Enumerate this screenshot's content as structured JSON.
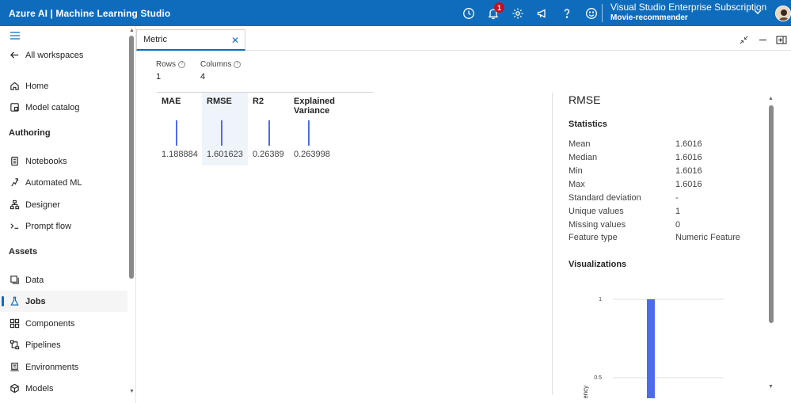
{
  "app": {
    "title": "Azure AI | Machine Learning Studio"
  },
  "header": {
    "notification_count": "1",
    "subscription": "Visual Studio Enterprise Subscription",
    "workspace": "Movie-recommender",
    "icons": [
      "clock-icon",
      "bell-icon",
      "gear-icon",
      "megaphone-icon",
      "help-icon",
      "smiley-icon"
    ]
  },
  "sidebar": {
    "all_workspaces": "All workspaces",
    "items_top": [
      {
        "label": "Home",
        "icon": "home-icon"
      },
      {
        "label": "Model catalog",
        "icon": "catalog-icon"
      }
    ],
    "authoring_title": "Authoring",
    "authoring": [
      {
        "label": "Notebooks",
        "icon": "notebook-icon"
      },
      {
        "label": "Automated ML",
        "icon": "automl-icon"
      },
      {
        "label": "Designer",
        "icon": "designer-icon"
      },
      {
        "label": "Prompt flow",
        "icon": "prompt-icon"
      }
    ],
    "assets_title": "Assets",
    "assets": [
      {
        "label": "Data",
        "icon": "data-icon"
      },
      {
        "label": "Jobs",
        "icon": "flask-icon",
        "active": true
      },
      {
        "label": "Components",
        "icon": "components-icon"
      },
      {
        "label": "Pipelines",
        "icon": "pipelines-icon"
      },
      {
        "label": "Environments",
        "icon": "environments-icon"
      },
      {
        "label": "Models",
        "icon": "models-icon"
      }
    ]
  },
  "tab": {
    "label": "Metric"
  },
  "summary": {
    "rows_label": "Rows",
    "rows_value": "1",
    "columns_label": "Columns",
    "columns_value": "4"
  },
  "metrics": [
    {
      "name": "MAE",
      "value": "1.188884"
    },
    {
      "name": "RMSE",
      "value": "1.601623",
      "selected": true
    },
    {
      "name": "R2",
      "value": "0.26389"
    },
    {
      "name": "Explained Variance",
      "value": "0.263998"
    }
  ],
  "details": {
    "title": "RMSE",
    "statistics_title": "Statistics",
    "statistics": [
      {
        "key": "Mean",
        "value": "1.6016"
      },
      {
        "key": "Median",
        "value": "1.6016"
      },
      {
        "key": "Min",
        "value": "1.6016"
      },
      {
        "key": "Max",
        "value": "1.6016"
      },
      {
        "key": "Standard deviation",
        "value": "-"
      },
      {
        "key": "Unique values",
        "value": "1"
      },
      {
        "key": "Missing values",
        "value": "0"
      },
      {
        "key": "Feature type",
        "value": "Numeric Feature"
      }
    ],
    "visualizations_title": "Visualizations"
  },
  "chart_data": {
    "type": "bar",
    "ylabel": "Frequency",
    "ytick_labels": [
      "1",
      "0.5"
    ],
    "values": [
      1
    ],
    "color": "#4f6bed"
  }
}
